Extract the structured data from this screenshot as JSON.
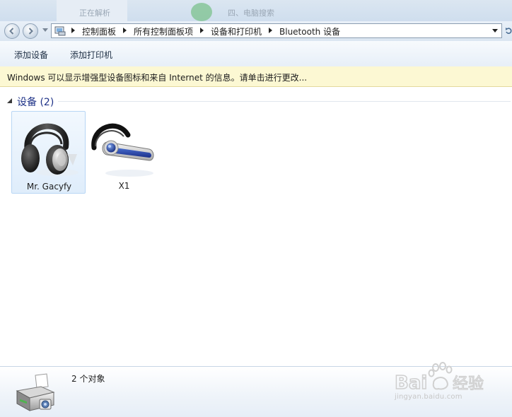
{
  "breadcrumb": [
    "控制面板",
    "所有控制面板项",
    "设备和打印机",
    "Bluetooth 设备"
  ],
  "toolbar": {
    "add_device_label": "添加设备",
    "add_printer_label": "添加打印机"
  },
  "infobar": {
    "text": "Windows 可以显示增强型设备图标和来自 Internet 的信息。请单击进行更改..."
  },
  "devices_group": {
    "title": "设备 (2)",
    "items": [
      {
        "label": "Mr. Gacyfy",
        "icon": "headphones-icon",
        "selected": true
      },
      {
        "label": "X1",
        "icon": "bluetooth-headset-icon",
        "selected": false
      }
    ]
  },
  "details": {
    "object_count": "2 个对象",
    "icon": "printer-icon"
  },
  "background_window": {
    "text_left": "正在解析",
    "text_right": "四、电脑搜索"
  },
  "watermark": {
    "logo_text": "Baidu经验",
    "url": "jingyan.baidu.com"
  },
  "colors": {
    "selection_fill": "#dfedfb",
    "selection_border": "#b8d6f5",
    "infobar_bg": "#fcf8d3",
    "group_title": "#1e3287"
  }
}
